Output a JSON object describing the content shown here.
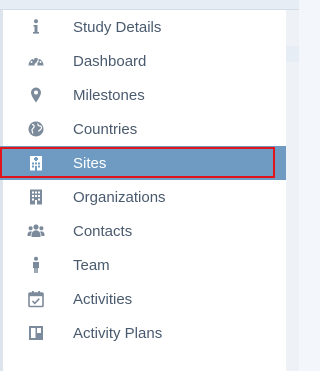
{
  "sidebar": {
    "active_index": 4,
    "items": [
      {
        "label": "Study Details",
        "icon": "info-icon"
      },
      {
        "label": "Dashboard",
        "icon": "dashboard-gauge-icon"
      },
      {
        "label": "Milestones",
        "icon": "map-pin-icon"
      },
      {
        "label": "Countries",
        "icon": "globe-icon"
      },
      {
        "label": "Sites",
        "icon": "hospital-building-icon"
      },
      {
        "label": "Organizations",
        "icon": "building-icon"
      },
      {
        "label": "Contacts",
        "icon": "users-group-icon"
      },
      {
        "label": "Team",
        "icon": "person-icon"
      },
      {
        "label": "Activities",
        "icon": "calendar-check-icon"
      },
      {
        "label": "Activity Plans",
        "icon": "panel-layout-icon"
      }
    ]
  },
  "colors": {
    "icon": "#7c8b9b",
    "text": "#4a5a6e",
    "active_bg": "#6f9bc2",
    "active_text": "#ffffff",
    "highlight_border": "#e0141b"
  }
}
